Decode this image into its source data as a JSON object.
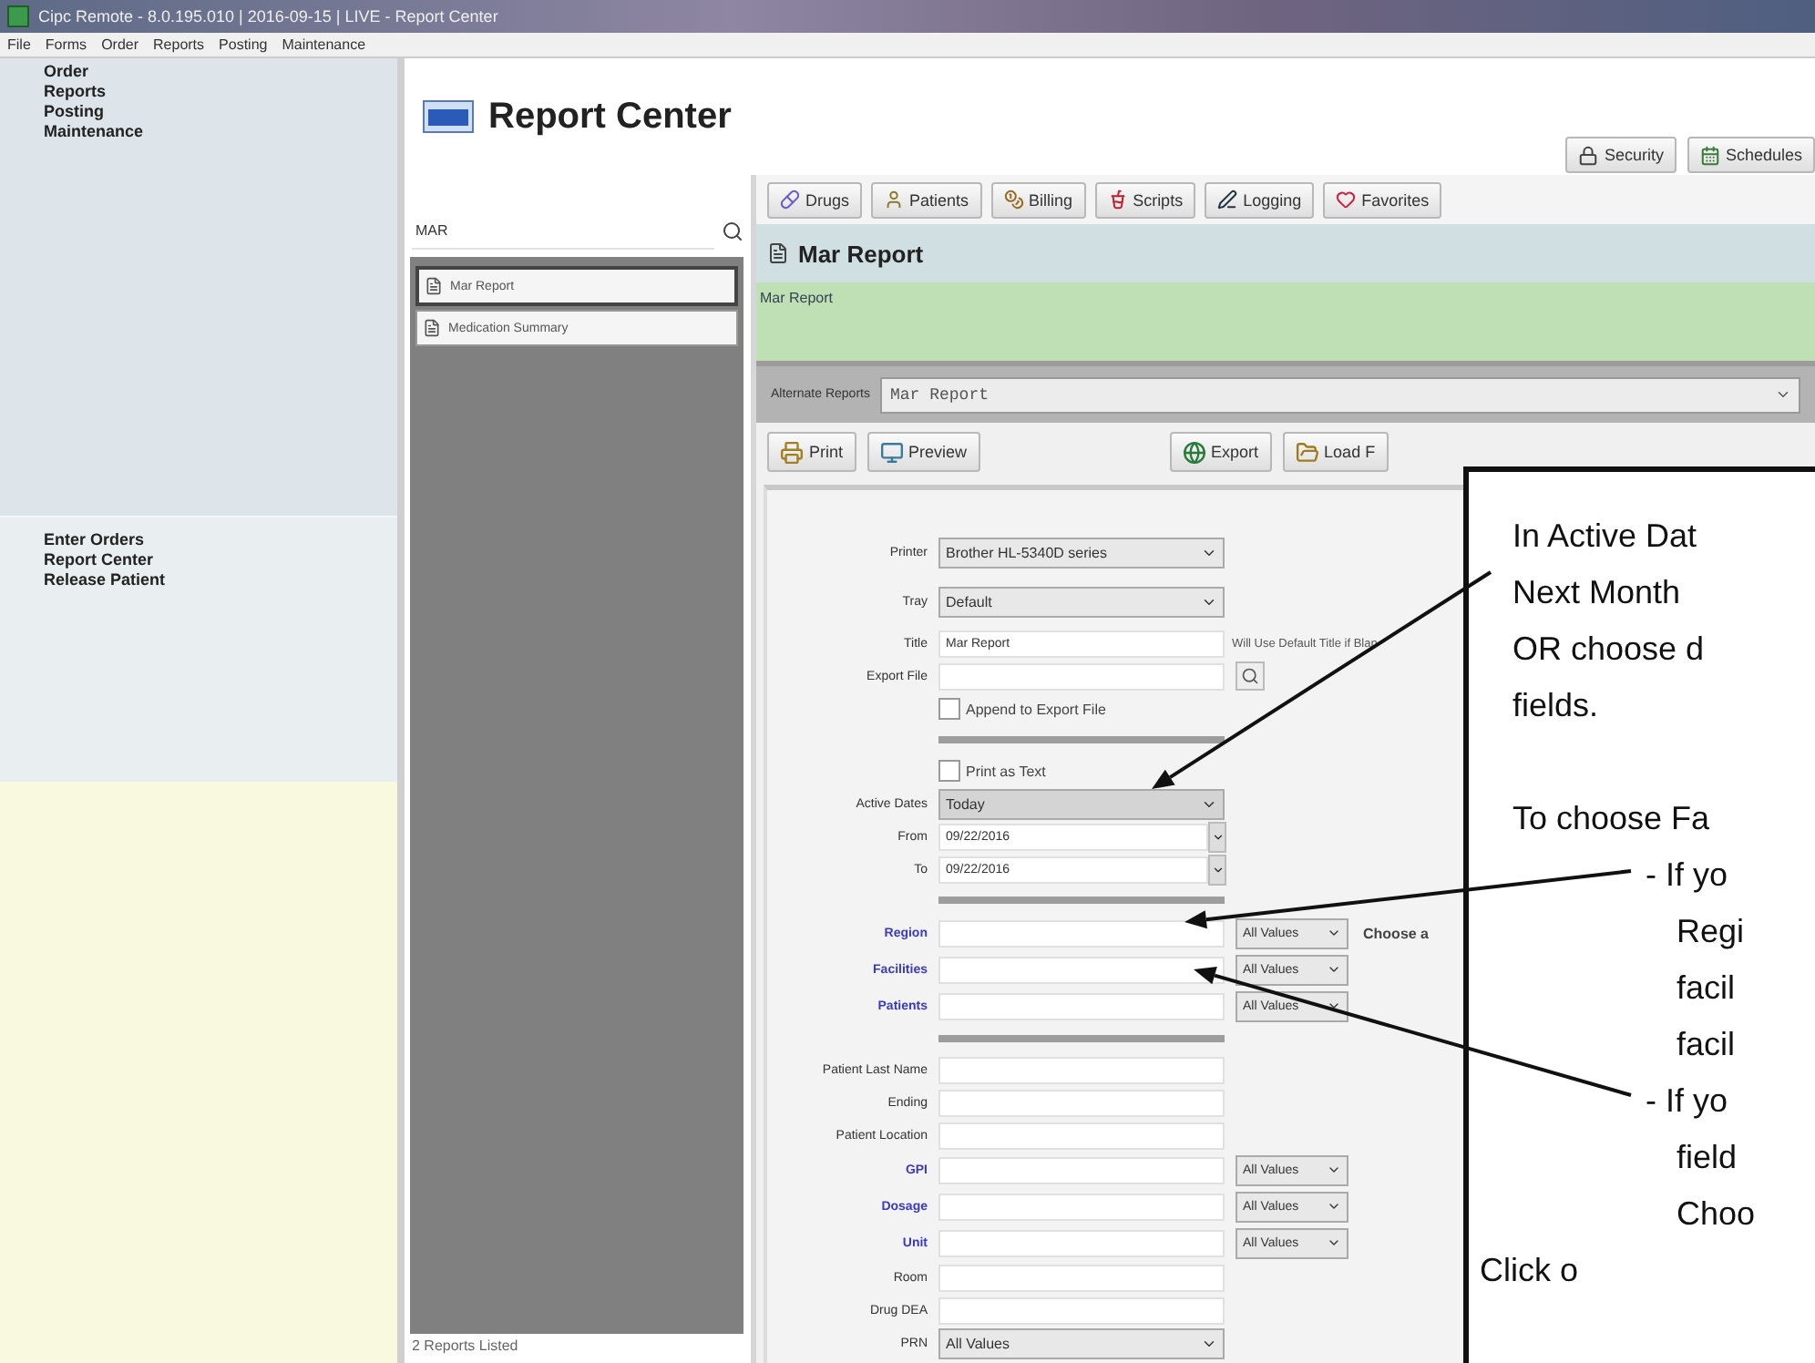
{
  "window": {
    "title": "Cipc Remote - 8.0.195.010 | 2016-09-15 | LIVE - Report Center"
  },
  "menu": [
    "File",
    "Forms",
    "Order",
    "Reports",
    "Posting",
    "Maintenance"
  ],
  "nav": {
    "sections": [
      "Order",
      "Reports",
      "Posting",
      "Maintenance"
    ],
    "tasks": [
      "Enter Orders",
      "Report Center",
      "Release Patient"
    ]
  },
  "header": {
    "title": "Report Center",
    "buttons": [
      {
        "label": "Security",
        "kind": "lock"
      },
      {
        "label": "Schedules",
        "kind": "calendar"
      }
    ]
  },
  "categories": [
    {
      "label": "Drugs",
      "kind": "pill"
    },
    {
      "label": "Patients",
      "kind": "person"
    },
    {
      "label": "Billing",
      "kind": "coins"
    },
    {
      "label": "Scripts",
      "kind": "cup"
    },
    {
      "label": "Logging",
      "kind": "pen"
    },
    {
      "label": "Favorites",
      "kind": "heart"
    }
  ],
  "search": {
    "value": "MAR"
  },
  "reports": [
    {
      "label": "Mar Report",
      "selected": true
    },
    {
      "label": "Medication Summary",
      "selected": false
    }
  ],
  "list_status": "2 Reports Listed",
  "report": {
    "title": "Mar Report",
    "description": "Mar Report",
    "alternate_label": "Alternate Reports",
    "alternate_value": "Mar Report"
  },
  "actions": [
    {
      "label": "Print",
      "kind": "printer"
    },
    {
      "label": "Preview",
      "kind": "monitor"
    },
    {
      "label": "Export",
      "kind": "globe"
    },
    {
      "label": "Load F",
      "kind": "folder"
    }
  ],
  "form": [
    {
      "kind": "select",
      "label": "Printer",
      "value": "Brother HL-5340D series"
    },
    {
      "kind": "select",
      "label": "Tray",
      "value": "Default"
    },
    {
      "kind": "text",
      "label": "Title",
      "value": "Mar Report",
      "note": "Will Use Default Title if Blan"
    },
    {
      "kind": "file",
      "label": "Export File"
    },
    {
      "kind": "checkbox",
      "label": "Append to Export File",
      "checked": false
    },
    {
      "kind": "separator"
    },
    {
      "kind": "checkbox",
      "label": "Print as Text",
      "checked": false
    },
    {
      "kind": "select",
      "label": "Active Dates",
      "value": "Today"
    },
    {
      "kind": "date",
      "label": "From",
      "value": "09/22/2016"
    },
    {
      "kind": "date",
      "label": "To",
      "value": "09/22/2016"
    },
    {
      "kind": "separator"
    },
    {
      "kind": "filter",
      "label": "Region",
      "option": "All Values",
      "note": "Choose a"
    },
    {
      "kind": "filter",
      "label": "Facilities",
      "option": "All Values"
    },
    {
      "kind": "filter",
      "label": "Patients",
      "option": "All Values"
    },
    {
      "kind": "separator"
    },
    {
      "kind": "text",
      "label": "Patient Last Name"
    },
    {
      "kind": "text",
      "label": "Ending"
    },
    {
      "kind": "text",
      "label": "Patient Location"
    },
    {
      "kind": "filter",
      "label": "GPI",
      "option": "All Values"
    },
    {
      "kind": "filter",
      "label": "Dosage",
      "option": "All Values"
    },
    {
      "kind": "filter",
      "label": "Unit",
      "option": "All Values"
    },
    {
      "kind": "text",
      "label": "Room"
    },
    {
      "kind": "text",
      "label": "Drug DEA"
    },
    {
      "kind": "select",
      "label": "PRN",
      "value": "All Values"
    }
  ],
  "callout": [
    {
      "kind": "para",
      "text": "In Active Dat"
    },
    {
      "kind": "para",
      "text": "Next Month"
    },
    {
      "kind": "para",
      "text": "OR choose d"
    },
    {
      "kind": "para",
      "text": "fields."
    },
    {
      "kind": "gap"
    },
    {
      "kind": "para",
      "text": "To choose Fa"
    },
    {
      "kind": "bullet",
      "text": "- If yo"
    },
    {
      "kind": "cont",
      "text": "Regi"
    },
    {
      "kind": "cont",
      "text": "facil"
    },
    {
      "kind": "cont",
      "text": "facil"
    },
    {
      "kind": "bullet",
      "text": "- If yo"
    },
    {
      "kind": "cont",
      "text": "field"
    },
    {
      "kind": "cont",
      "text": "Choo"
    },
    {
      "kind": "final",
      "text": "Click o"
    }
  ]
}
